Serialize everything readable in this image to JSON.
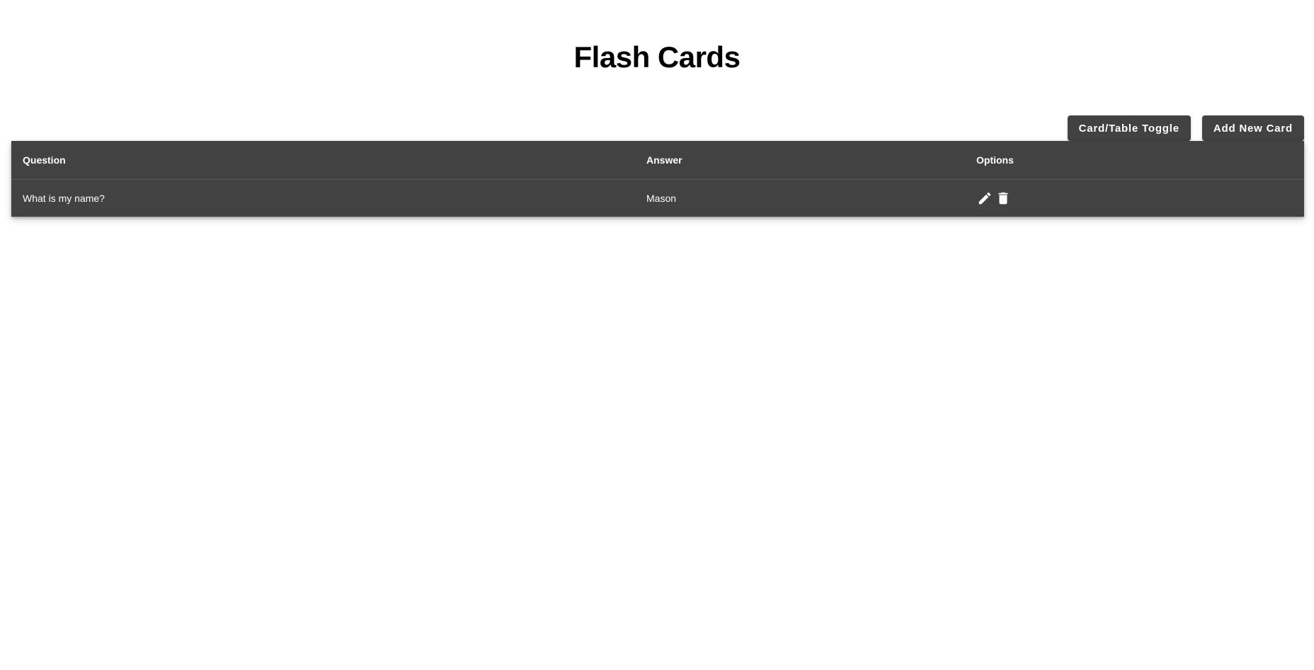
{
  "page": {
    "title": "Flash Cards"
  },
  "toolbar": {
    "toggle_label": "Card/Table Toggle",
    "add_label": "Add New Card"
  },
  "table": {
    "headers": {
      "question": "Question",
      "answer": "Answer",
      "options": "Options"
    },
    "rows": [
      {
        "question": "What is my name?",
        "answer": "Mason"
      }
    ]
  },
  "icons": {
    "edit": "pencil-icon",
    "delete": "trash-icon"
  },
  "colors": {
    "surface": "#424242",
    "text": "#ffffff",
    "title": "#000000"
  }
}
